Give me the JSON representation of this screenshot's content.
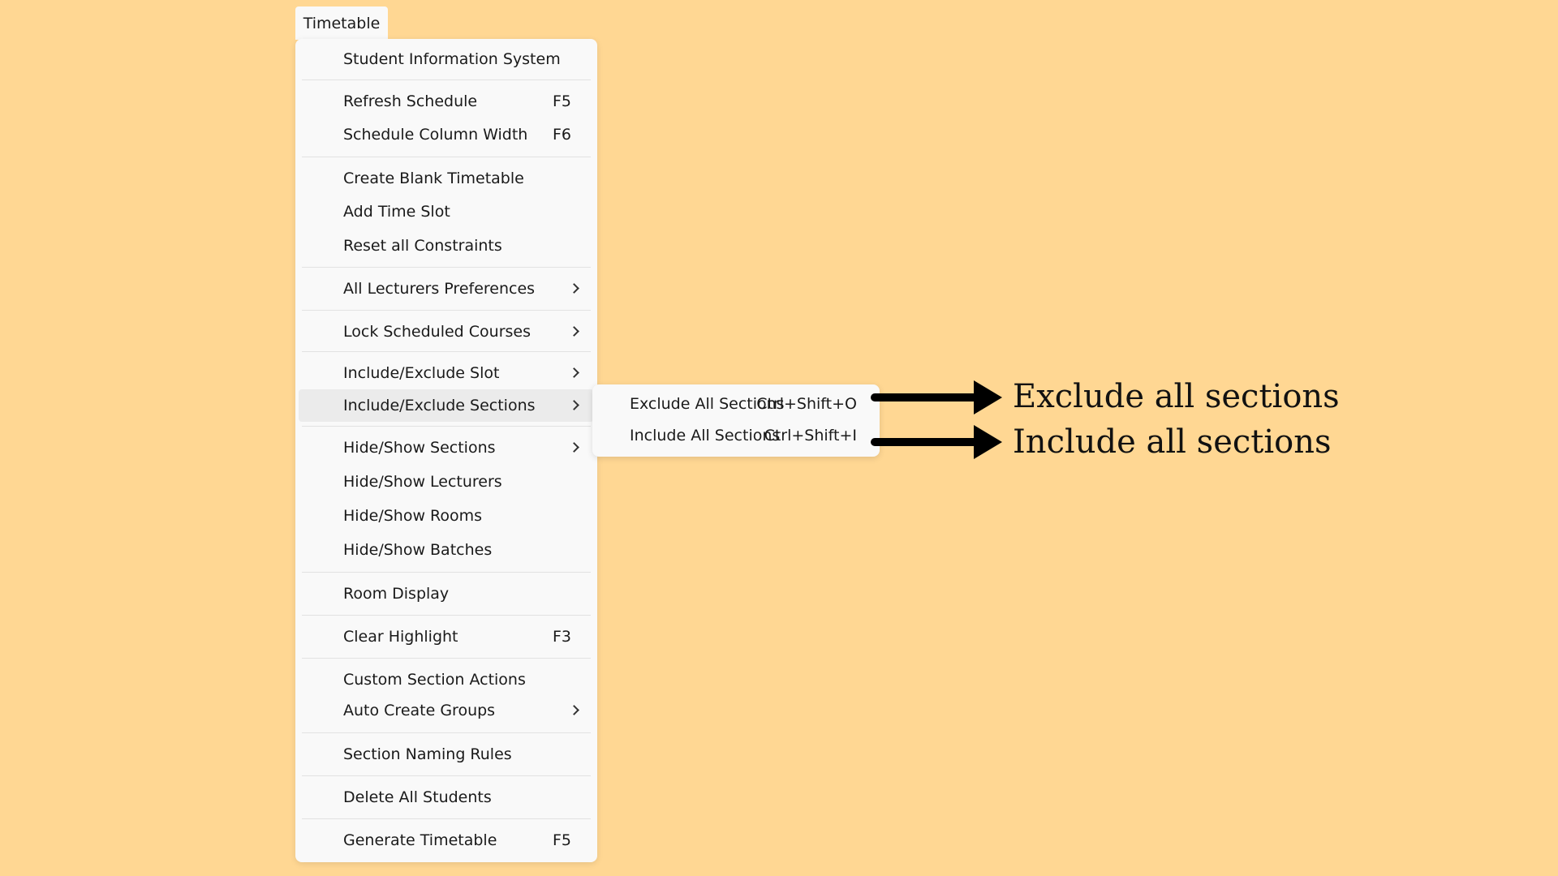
{
  "colors": {
    "background": "#FFD793",
    "menu_bg": "#F9F9F9",
    "highlight": "#EBEBEB",
    "separator": "#E2E2E2",
    "text": "#1A1A1A",
    "arrow": "#000000"
  },
  "menubar": {
    "title": "Timetable"
  },
  "menu": {
    "items": [
      {
        "label": "Student Information System",
        "shortcut": "",
        "submenu": false
      },
      {
        "label": "Refresh Schedule",
        "shortcut": "F5",
        "submenu": false
      },
      {
        "label": "Schedule Column Width",
        "shortcut": "F6",
        "submenu": false
      },
      {
        "label": "Create Blank Timetable",
        "shortcut": "",
        "submenu": false
      },
      {
        "label": "Add Time Slot",
        "shortcut": "",
        "submenu": false
      },
      {
        "label": "Reset all Constraints",
        "shortcut": "",
        "submenu": false
      },
      {
        "label": "All Lecturers Preferences",
        "shortcut": "",
        "submenu": true,
        "icon": "chevron-right-icon"
      },
      {
        "label": "Lock Scheduled Courses",
        "shortcut": "",
        "submenu": true,
        "icon": "chevron-right-icon"
      },
      {
        "label": "Include/Exclude Slot",
        "shortcut": "",
        "submenu": true,
        "icon": "chevron-right-icon"
      },
      {
        "label": "Include/Exclude Sections",
        "shortcut": "",
        "submenu": true,
        "icon": "chevron-right-icon",
        "highlighted": true
      },
      {
        "label": "Hide/Show Sections",
        "shortcut": "",
        "submenu": true,
        "icon": "chevron-right-icon"
      },
      {
        "label": "Hide/Show Lecturers",
        "shortcut": "",
        "submenu": false
      },
      {
        "label": "Hide/Show Rooms",
        "shortcut": "",
        "submenu": false
      },
      {
        "label": "Hide/Show Batches",
        "shortcut": "",
        "submenu": false
      },
      {
        "label": "Room Display",
        "shortcut": "",
        "submenu": false
      },
      {
        "label": "Clear Highlight",
        "shortcut": "F3",
        "submenu": false
      },
      {
        "label": "Custom Section Actions",
        "shortcut": "",
        "submenu": false
      },
      {
        "label": "Auto Create Groups",
        "shortcut": "",
        "submenu": true,
        "icon": "chevron-right-icon"
      },
      {
        "label": "Section Naming Rules",
        "shortcut": "",
        "submenu": false
      },
      {
        "label": "Delete All Students",
        "shortcut": "",
        "submenu": false
      },
      {
        "label": "Generate Timetable",
        "shortcut": "F5",
        "submenu": false
      }
    ]
  },
  "submenu": {
    "items": [
      {
        "label": "Exclude All Sections",
        "shortcut": "Ctrl+Shift+O"
      },
      {
        "label": "Include All Sections",
        "shortcut": "Ctrl+Shift+I"
      }
    ]
  },
  "annotations": [
    {
      "text": "Exclude all sections",
      "icon": "arrow-right-icon"
    },
    {
      "text": "Include all sections",
      "icon": "arrow-right-icon"
    }
  ]
}
